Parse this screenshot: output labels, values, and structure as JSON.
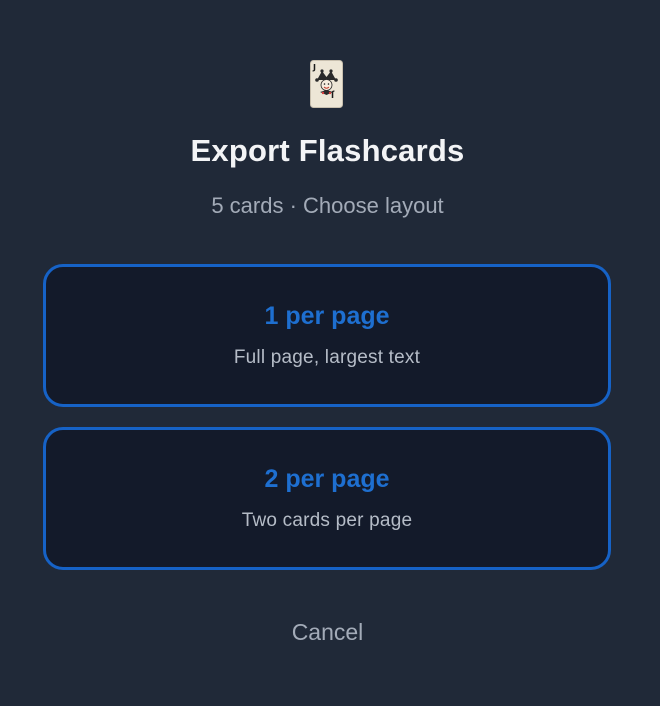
{
  "dialog": {
    "icon": "joker-card-icon",
    "title": "Export Flashcards",
    "subtitle": "5 cards · Choose layout",
    "options": [
      {
        "label": "1 per page",
        "description": "Full page, largest text"
      },
      {
        "label": "2 per page",
        "description": "Two cards per page"
      }
    ],
    "cancel_label": "Cancel"
  },
  "colors": {
    "background": "#202938",
    "card_background": "#131a2a",
    "accent": "#1662c6",
    "title_text": "#f3f4f6",
    "muted_text": "#a3abb8"
  }
}
